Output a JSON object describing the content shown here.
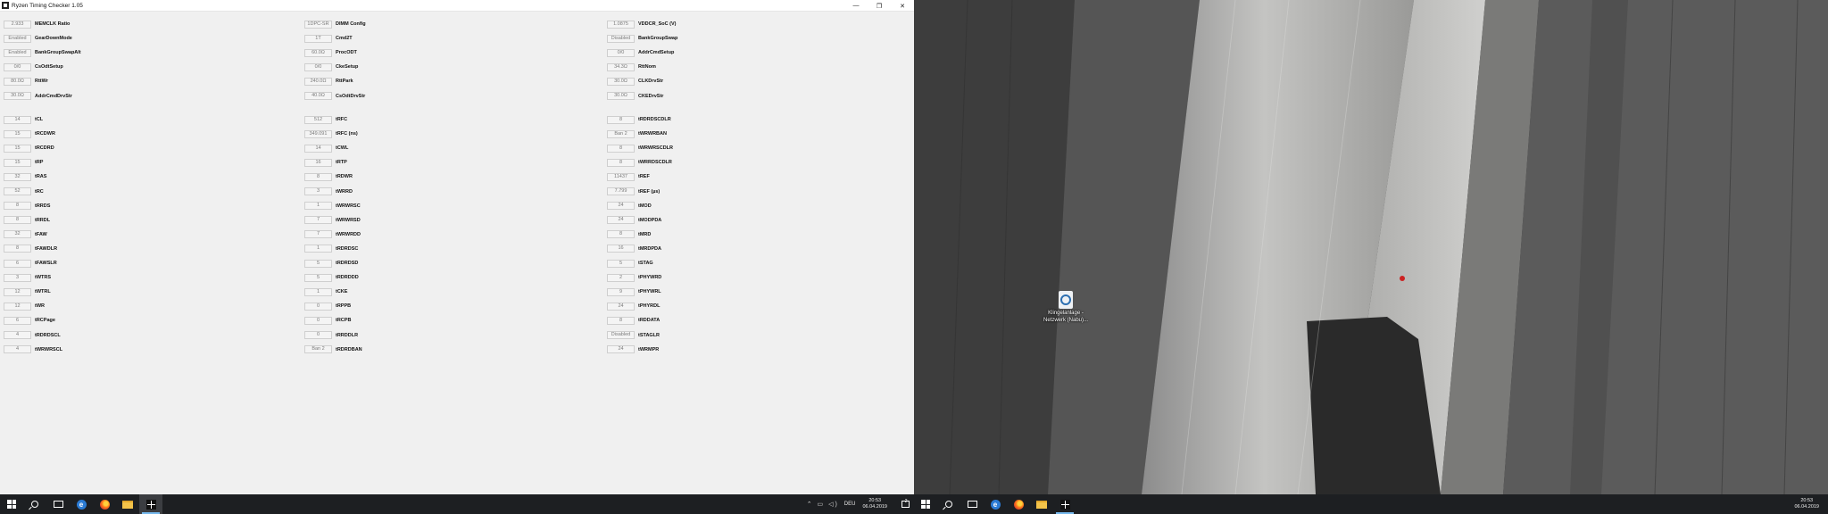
{
  "window": {
    "title": "Ryzen Timing Checker 1.05",
    "minimize_glyph": "—",
    "maximize_glyph": "❐",
    "close_glyph": "✕"
  },
  "columns": [
    [
      {
        "value": "2.933",
        "label": "MEMCLK Ratio"
      },
      {
        "value": "Enabled",
        "label": "GearDownMode"
      },
      {
        "value": "Enabled",
        "label": "BankGroupSwapAlt"
      },
      {
        "value": "0/0",
        "label": "CsOdtSetup"
      },
      {
        "value": "80.0Ω",
        "label": "RttWr"
      },
      {
        "value": "30.0Ω",
        "label": "AddrCmdDrvStr"
      },
      null,
      {
        "value": "14",
        "label": "tCL"
      },
      {
        "value": "15",
        "label": "tRCDWR"
      },
      {
        "value": "15",
        "label": "tRCDRD"
      },
      {
        "value": "15",
        "label": "tRP"
      },
      {
        "value": "32",
        "label": "tRAS"
      },
      {
        "value": "52",
        "label": "tRC"
      },
      {
        "value": "8",
        "label": "tRRDS"
      },
      {
        "value": "8",
        "label": "tRRDL"
      },
      {
        "value": "32",
        "label": "tFAW"
      },
      {
        "value": "8",
        "label": "tFAWDLR"
      },
      {
        "value": "6",
        "label": "tFAWSLR"
      },
      {
        "value": "3",
        "label": "tWTRS"
      },
      {
        "value": "12",
        "label": "tWTRL"
      },
      {
        "value": "12",
        "label": "tWR"
      },
      {
        "value": "6",
        "label": "tRCPage"
      },
      {
        "value": "4",
        "label": "tRDRDSCL"
      },
      {
        "value": "4",
        "label": "tWRWRSCL"
      }
    ],
    [
      {
        "value": "1DPC-SR",
        "label": "DIMM Config"
      },
      {
        "value": "1T",
        "label": "Cmd2T"
      },
      {
        "value": "60.0Ω",
        "label": "ProcODT"
      },
      {
        "value": "0/0",
        "label": "CkeSetup"
      },
      {
        "value": "240.0Ω",
        "label": "RttPark"
      },
      {
        "value": "40.0Ω",
        "label": "CsOdtDrvStr"
      },
      null,
      {
        "value": "512",
        "label": "tRFC"
      },
      {
        "value": "349.091",
        "label": "tRFC (ns)"
      },
      {
        "value": "14",
        "label": "tCWL"
      },
      {
        "value": "16",
        "label": "tRTP"
      },
      {
        "value": "8",
        "label": "tRDWR"
      },
      {
        "value": "3",
        "label": "tWRRD"
      },
      {
        "value": "1",
        "label": "tWRWRSC"
      },
      {
        "value": "7",
        "label": "tWRWRSD"
      },
      {
        "value": "7",
        "label": "tWRWRDD"
      },
      {
        "value": "1",
        "label": "tRDRDSC"
      },
      {
        "value": "5",
        "label": "tRDRDSD"
      },
      {
        "value": "5",
        "label": "tRDRDDD"
      },
      {
        "value": "1",
        "label": "tCKE"
      },
      {
        "value": "0",
        "label": "tRPPB"
      },
      {
        "value": "0",
        "label": "tRCPB"
      },
      {
        "value": "0",
        "label": "tRRDDLR"
      },
      {
        "value": "Ban 2",
        "label": "tRDRDBAN"
      }
    ],
    [
      {
        "value": "1.0875",
        "label": "VDDCR_SoC (V)"
      },
      {
        "value": "Disabled",
        "label": "BankGroupSwap"
      },
      {
        "value": "0/0",
        "label": "AddrCmdSetup"
      },
      {
        "value": "34.3Ω",
        "label": "RttNom"
      },
      {
        "value": "30.0Ω",
        "label": "CLKDrvStr"
      },
      {
        "value": "30.0Ω",
        "label": "CKEDrvStr"
      },
      null,
      {
        "value": "8",
        "label": "tRDRDSCDLR"
      },
      {
        "value": "Ban 2",
        "label": "tWRWRBAN"
      },
      {
        "value": "8",
        "label": "tWRWRSCDLR"
      },
      {
        "value": "8",
        "label": "tWRRDSCDLR"
      },
      {
        "value": "11437",
        "label": "tREF"
      },
      {
        "value": "7.799",
        "label": "tREF (µs)"
      },
      {
        "value": "24",
        "label": "tMOD"
      },
      {
        "value": "24",
        "label": "tMODPDA"
      },
      {
        "value": "8",
        "label": "tMRD"
      },
      {
        "value": "16",
        "label": "tMRDPDA"
      },
      {
        "value": "5",
        "label": "tSTAG"
      },
      {
        "value": "2",
        "label": "tPHYWRD"
      },
      {
        "value": "9",
        "label": "tPHYWRL"
      },
      {
        "value": "24",
        "label": "tPHYRDL"
      },
      {
        "value": "8",
        "label": "tRDDATA"
      },
      {
        "value": "Disabled",
        "label": "tSTAGLR"
      },
      {
        "value": "24",
        "label": "tWRMPR"
      }
    ]
  ],
  "taskbar_left": {
    "tray_lang": "DEU",
    "time": "20:53",
    "date": "06.04.2019",
    "tray_icons": "⌃ ▭ ◁)",
    "notif_count": "2"
  },
  "taskbar_right": {
    "time": "20:53",
    "date": "06.04.2019"
  },
  "desktop": {
    "icon_label": "Klingelanlage - Netzwerk (Nabu)..."
  },
  "colors": {
    "window_bg": "#f0f0f0",
    "taskbar_bg": "#1d1f22",
    "accent": "#76b9ed"
  }
}
